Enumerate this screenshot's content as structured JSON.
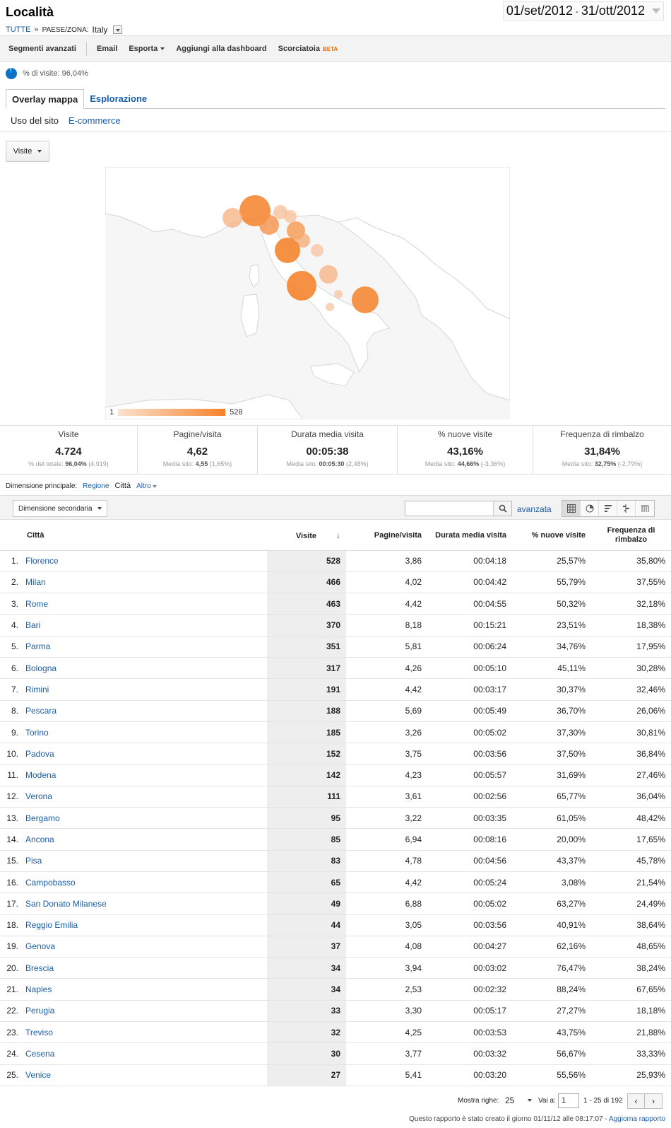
{
  "header": {
    "title": "Località",
    "breadcrumb_all": "TUTTE",
    "breadcrumb_sep": "»",
    "breadcrumb_label": "PAESE/ZONA:",
    "breadcrumb_value": "Italy",
    "date_start": "01/set/2012",
    "date_sep": "-",
    "date_end": "31/ott/2012"
  },
  "toolbar": {
    "segments": "Segmenti avanzati",
    "email": "Email",
    "export": "Esporta",
    "dashboard": "Aggiungi alla dashboard",
    "shortcut": "Scorciatoia",
    "beta": "BETA"
  },
  "percent_visits": "% di visite: 96,04%",
  "tabs": [
    {
      "label": "Overlay mappa"
    },
    {
      "label": "Esplorazione"
    }
  ],
  "subtabs": [
    {
      "label": "Uso del sito"
    },
    {
      "label": "E-commerce"
    }
  ],
  "metric_select": "Visite",
  "map": {
    "legend_min": "1",
    "legend_max": "528",
    "accent_color": "#f5822a",
    "light_color": "#fbe3d1"
  },
  "summary": [
    {
      "label": "Visite",
      "value": "4.724",
      "sub_prefix": "% del totale:",
      "sub_bold": "96,04%",
      "sub_rest": "(4.919)"
    },
    {
      "label": "Pagine/visita",
      "value": "4,62",
      "sub_prefix": "Media sito:",
      "sub_bold": "4,55",
      "sub_rest": "(1,65%)"
    },
    {
      "label": "Durata media visita",
      "value": "00:05:38",
      "sub_prefix": "Media sito:",
      "sub_bold": "00:05:30",
      "sub_rest": "(2,48%)"
    },
    {
      "label": "% nuove visite",
      "value": "43,16%",
      "sub_prefix": "Media sito:",
      "sub_bold": "44,66%",
      "sub_rest": "(-3,36%)"
    },
    {
      "label": "Frequenza di rimbalzo",
      "value": "31,84%",
      "sub_prefix": "Media sito:",
      "sub_bold": "32,75%",
      "sub_rest": "(-2,79%)"
    }
  ],
  "dimension": {
    "label": "Dimensione principale:",
    "region": "Regione",
    "city": "Città",
    "more": "Altro"
  },
  "table_toolbar": {
    "secondary": "Dimensione secondaria",
    "advanced": "avanzata"
  },
  "table": {
    "headers": {
      "city": "Città",
      "visits": "Visite",
      "pages": "Pagine/visita",
      "duration": "Durata media visita",
      "new_visits": "% nuove visite",
      "bounce": "Frequenza di rimbalzo"
    },
    "rows": [
      {
        "n": "1.",
        "city": "Florence",
        "visits": "528",
        "pages": "3,86",
        "duration": "00:04:18",
        "new": "25,57%",
        "bounce": "35,80%"
      },
      {
        "n": "2.",
        "city": "Milan",
        "visits": "466",
        "pages": "4,02",
        "duration": "00:04:42",
        "new": "55,79%",
        "bounce": "37,55%"
      },
      {
        "n": "3.",
        "city": "Rome",
        "visits": "463",
        "pages": "4,42",
        "duration": "00:04:55",
        "new": "50,32%",
        "bounce": "32,18%"
      },
      {
        "n": "4.",
        "city": "Bari",
        "visits": "370",
        "pages": "8,18",
        "duration": "00:15:21",
        "new": "23,51%",
        "bounce": "18,38%"
      },
      {
        "n": "5.",
        "city": "Parma",
        "visits": "351",
        "pages": "5,81",
        "duration": "00:06:24",
        "new": "34,76%",
        "bounce": "17,95%"
      },
      {
        "n": "6.",
        "city": "Bologna",
        "visits": "317",
        "pages": "4,26",
        "duration": "00:05:10",
        "new": "45,11%",
        "bounce": "30,28%"
      },
      {
        "n": "7.",
        "city": "Rimini",
        "visits": "191",
        "pages": "4,42",
        "duration": "00:03:17",
        "new": "30,37%",
        "bounce": "32,46%"
      },
      {
        "n": "8.",
        "city": "Pescara",
        "visits": "188",
        "pages": "5,69",
        "duration": "00:05:49",
        "new": "36,70%",
        "bounce": "26,06%"
      },
      {
        "n": "9.",
        "city": "Torino",
        "visits": "185",
        "pages": "3,26",
        "duration": "00:05:02",
        "new": "37,30%",
        "bounce": "30,81%"
      },
      {
        "n": "10.",
        "city": "Padova",
        "visits": "152",
        "pages": "3,75",
        "duration": "00:03:56",
        "new": "37,50%",
        "bounce": "36,84%"
      },
      {
        "n": "11.",
        "city": "Modena",
        "visits": "142",
        "pages": "4,23",
        "duration": "00:05:57",
        "new": "31,69%",
        "bounce": "27,46%"
      },
      {
        "n": "12.",
        "city": "Verona",
        "visits": "111",
        "pages": "3,61",
        "duration": "00:02:56",
        "new": "65,77%",
        "bounce": "36,04%"
      },
      {
        "n": "13.",
        "city": "Bergamo",
        "visits": "95",
        "pages": "3,22",
        "duration": "00:03:35",
        "new": "61,05%",
        "bounce": "48,42%"
      },
      {
        "n": "14.",
        "city": "Ancona",
        "visits": "85",
        "pages": "6,94",
        "duration": "00:08:16",
        "new": "20,00%",
        "bounce": "17,65%"
      },
      {
        "n": "15.",
        "city": "Pisa",
        "visits": "83",
        "pages": "4,78",
        "duration": "00:04:56",
        "new": "43,37%",
        "bounce": "45,78%"
      },
      {
        "n": "16.",
        "city": "Campobasso",
        "visits": "65",
        "pages": "4,42",
        "duration": "00:05:24",
        "new": "3,08%",
        "bounce": "21,54%"
      },
      {
        "n": "17.",
        "city": "San Donato Milanese",
        "visits": "49",
        "pages": "6,88",
        "duration": "00:05:02",
        "new": "63,27%",
        "bounce": "24,49%"
      },
      {
        "n": "18.",
        "city": "Reggio Emilia",
        "visits": "44",
        "pages": "3,05",
        "duration": "00:03:56",
        "new": "40,91%",
        "bounce": "38,64%"
      },
      {
        "n": "19.",
        "city": "Genova",
        "visits": "37",
        "pages": "4,08",
        "duration": "00:04:27",
        "new": "62,16%",
        "bounce": "48,65%"
      },
      {
        "n": "20.",
        "city": "Brescia",
        "visits": "34",
        "pages": "3,94",
        "duration": "00:03:02",
        "new": "76,47%",
        "bounce": "38,24%"
      },
      {
        "n": "21.",
        "city": "Naples",
        "visits": "34",
        "pages": "2,53",
        "duration": "00:02:32",
        "new": "88,24%",
        "bounce": "67,65%"
      },
      {
        "n": "22.",
        "city": "Perugia",
        "visits": "33",
        "pages": "3,30",
        "duration": "00:05:17",
        "new": "27,27%",
        "bounce": "18,18%"
      },
      {
        "n": "23.",
        "city": "Treviso",
        "visits": "32",
        "pages": "4,25",
        "duration": "00:03:53",
        "new": "43,75%",
        "bounce": "21,88%"
      },
      {
        "n": "24.",
        "city": "Cesena",
        "visits": "30",
        "pages": "3,77",
        "duration": "00:03:32",
        "new": "56,67%",
        "bounce": "33,33%"
      },
      {
        "n": "25.",
        "city": "Venice",
        "visits": "27",
        "pages": "5,41",
        "duration": "00:03:20",
        "new": "55,56%",
        "bounce": "25,93%"
      }
    ]
  },
  "pager": {
    "rows_label": "Mostra righe:",
    "rows_value": "25",
    "goto_label": "Vai a:",
    "goto_value": "1",
    "range": "1 - 25 di 192"
  },
  "footer": {
    "note": "Questo rapporto è stato creato il giorno 01/11/12 alle 08:17:07 -",
    "refresh": "Aggiorna rapporto"
  }
}
